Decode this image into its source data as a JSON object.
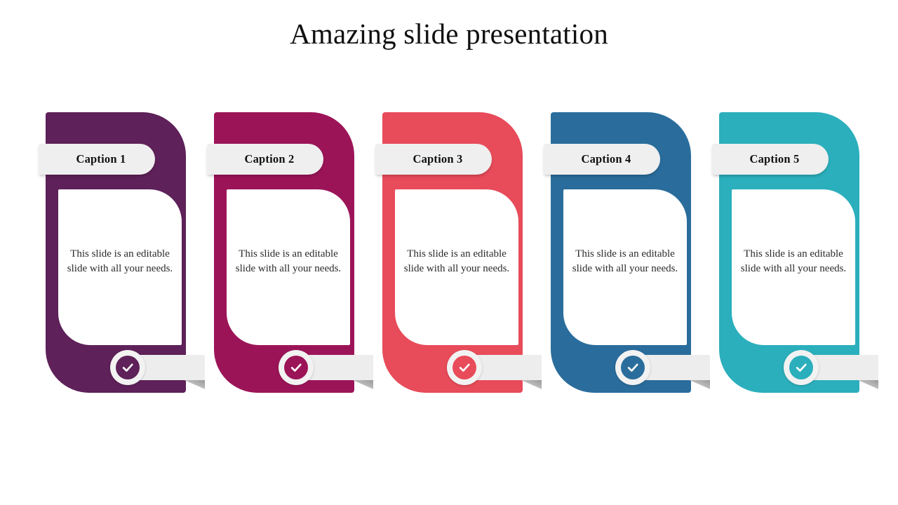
{
  "title": "Amazing slide presentation",
  "cards": [
    {
      "caption": "Caption 1",
      "body": "This slide is an editable slide with all your needs.",
      "color": "#5E2159",
      "check_icon": "check-icon"
    },
    {
      "caption": "Caption 2",
      "body": "This slide is an editable slide with all your needs.",
      "color": "#9C1458",
      "check_icon": "check-icon"
    },
    {
      "caption": "Caption 3",
      "body": "This slide is an editable slide with all your needs.",
      "color": "#E84B5A",
      "check_icon": "check-icon"
    },
    {
      "caption": "Caption 4",
      "body": "This slide is an editable slide with all your needs.",
      "color": "#2A6D9C",
      "check_icon": "check-icon"
    },
    {
      "caption": "Caption 5",
      "body": "This slide is an editable slide with all your needs.",
      "color": "#2BAFBC",
      "check_icon": "check-icon"
    }
  ],
  "palette": {
    "background": "#FFFFFF",
    "title_color": "#101010",
    "ribbon_gray": "#EFEFEF",
    "body_text": "#2B2B2B"
  }
}
